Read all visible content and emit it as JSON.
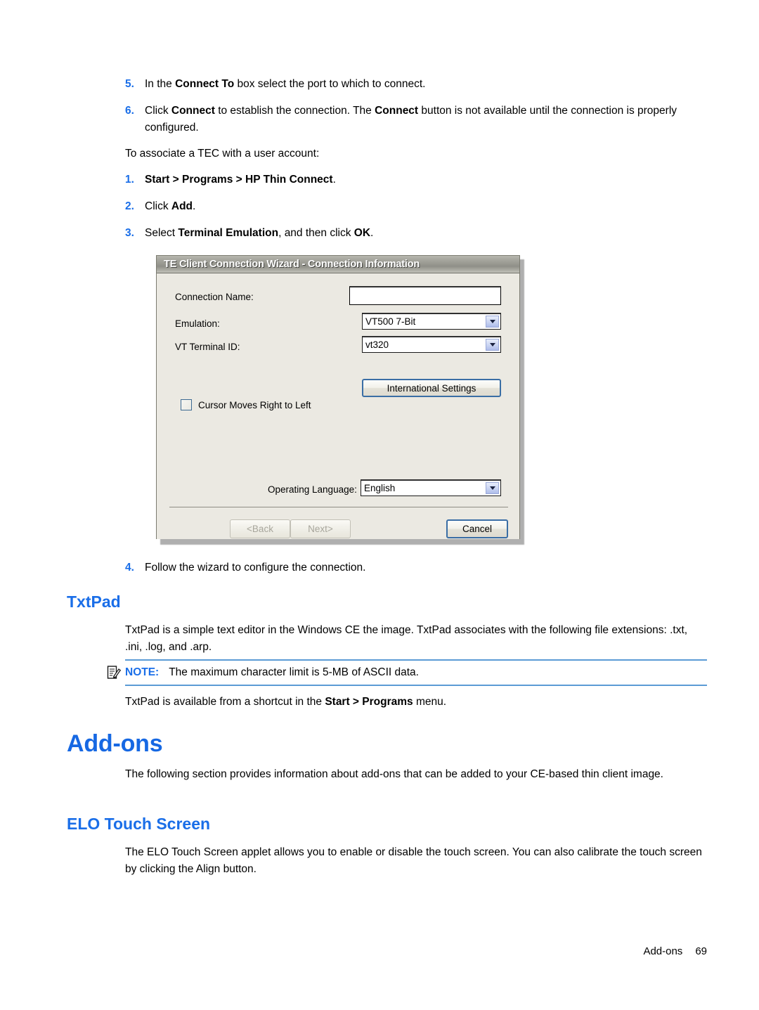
{
  "document": {
    "steps_connect": [
      {
        "number": "5.",
        "segments": [
          {
            "text": "In the ",
            "bold": false
          },
          {
            "text": "Connect To",
            "bold": true
          },
          {
            "text": " box select the port to which to connect.",
            "bold": false
          }
        ]
      },
      {
        "number": "6.",
        "segments": [
          {
            "text": "Click ",
            "bold": false
          },
          {
            "text": "Connect",
            "bold": true
          },
          {
            "text": " to establish the connection. The ",
            "bold": false
          },
          {
            "text": "Connect",
            "bold": true
          },
          {
            "text": " button is not available until the connection is properly configured.",
            "bold": false
          }
        ]
      }
    ],
    "intro_tec": "To associate a TEC with a user account:",
    "steps_tec": [
      {
        "number": "1.",
        "segments": [
          {
            "text": "Start > Programs > HP Thin Connect",
            "bold": true
          },
          {
            "text": ".",
            "bold": false
          }
        ]
      },
      {
        "number": "2.",
        "segments": [
          {
            "text": "Click ",
            "bold": false
          },
          {
            "text": "Add",
            "bold": true
          },
          {
            "text": ".",
            "bold": false
          }
        ]
      },
      {
        "number": "3.",
        "segments": [
          {
            "text": "Select ",
            "bold": false
          },
          {
            "text": "Terminal Emulation",
            "bold": true
          },
          {
            "text": ", and then click ",
            "bold": false
          },
          {
            "text": "OK",
            "bold": true
          },
          {
            "text": ".",
            "bold": false
          }
        ]
      }
    ],
    "step_after_figure": {
      "number": "4.",
      "segments": [
        {
          "text": "Follow the wizard to configure the connection.",
          "bold": false
        }
      ]
    },
    "txtpad": {
      "heading": "TxtPad",
      "paragraph": "TxtPad is a simple text editor in the Windows CE the image. TxtPad associates with the following file extensions: .txt, .ini, .log, and .arp.",
      "note": {
        "icon": "note-pencil-icon",
        "label": "NOTE:",
        "text": "The maximum character limit is 5-MB of ASCII data.",
        "rule_color": "#5b9bd5"
      },
      "availability": {
        "segments": [
          {
            "text": "TxtPad is available from a shortcut in the ",
            "bold": false
          },
          {
            "text": "Start > Programs",
            "bold": true
          },
          {
            "text": " menu.",
            "bold": false
          }
        ]
      }
    },
    "addons": {
      "heading": "Add-ons",
      "paragraph": "The following section provides information about add-ons that can be added to your CE-based thin client image."
    },
    "elo": {
      "heading": "ELO Touch Screen",
      "paragraph": "The ELO Touch Screen applet allows you to enable or disable the touch screen. You can also calibrate the touch screen by clicking the Align button."
    },
    "footer": {
      "section": "Add-ons",
      "page_number": "69"
    },
    "colors": {
      "heading_blue": "#1a6ee8",
      "list_marker_blue": "#1a6ee8",
      "note_rule_blue": "#5b9bd5"
    }
  },
  "dialog": {
    "title": "TE Client Connection Wizard - Connection Information",
    "fields": {
      "connection_name": {
        "label": "Connection Name:",
        "label_mnemonic": "m",
        "value": "",
        "placeholder": ""
      },
      "emulation": {
        "label": "Emulation:",
        "label_mnemonic": "E",
        "value": "VT500 7-Bit",
        "arrow_icon": "chevron-down-icon"
      },
      "vt_terminal_id": {
        "label": "VT Terminal ID:",
        "label_mnemonic": "V",
        "value": "vt320",
        "arrow_icon": "chevron-down-icon"
      },
      "operating_language": {
        "label": "Operating Language:",
        "label_mnemonic": "O",
        "value": "English",
        "arrow_icon": "chevron-down-icon"
      }
    },
    "international_settings_button": "International Settings",
    "cursor_checkbox": {
      "label": "Cursor Moves Right to Left",
      "checked": false
    },
    "buttons": {
      "back": "<Back",
      "next": "Next>",
      "cancel": "Cancel"
    }
  }
}
